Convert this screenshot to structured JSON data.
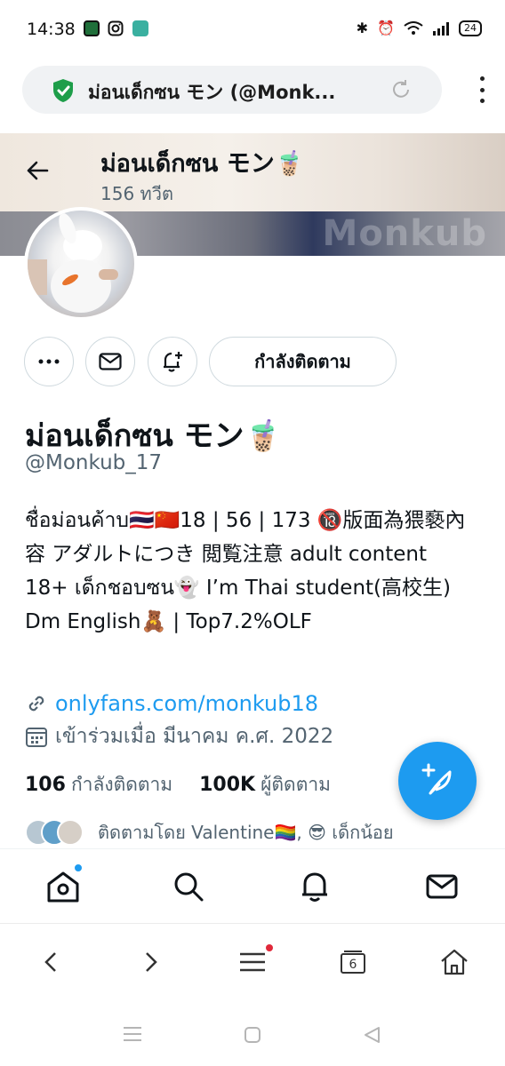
{
  "status_bar": {
    "time": "14:38",
    "battery": "24",
    "icons": [
      "app-icon",
      "instagram-icon",
      "messenger-icon",
      "bluetooth-icon",
      "alarm-icon",
      "wifi-icon",
      "signal-icon"
    ]
  },
  "browser": {
    "url_title": "ม่อนเด็กซน モン⁠ (@Monk...",
    "tabs_count": "6"
  },
  "header": {
    "name": "ม่อนเด็กซน モン🧋",
    "tweets_count": "156 ทวีต",
    "banner_watermark": "Monkub"
  },
  "actions": {
    "follow_label": "กำลังติดตาม"
  },
  "profile": {
    "name": "ม่อนเด็กซน モン🧋",
    "handle": "@Monkub_17",
    "bio": "ชื่อม่อนค้าบ🇹🇭🇨🇳18 | 56 | 173 🔞版面為猥褻內容 アダルトにつき 閲覧注意 adult content 18+ เด็กชอบซน👻 I’m Thai student(高校生) Dm English🧸 | Top7.2%OLF",
    "link": "onlyfans.com/monkub18",
    "joined": "เข้าร่วมเมื่อ มีนาคม ค.ศ. 2022",
    "following_count": "106",
    "following_label": "กำลังติดตาม",
    "followers_count": "100K",
    "followers_label": "ผู้ติดตาม",
    "followed_by": "ติดตามโดย Valentine🏳️‍🌈, 😎 เด็กน้อย"
  },
  "colors": {
    "accent": "#1d9bf0",
    "text_primary": "#0f1419",
    "text_secondary": "#536471",
    "border": "#cfd9de",
    "secure_green": "#1e9e4a",
    "notification_red": "#e0283a"
  }
}
